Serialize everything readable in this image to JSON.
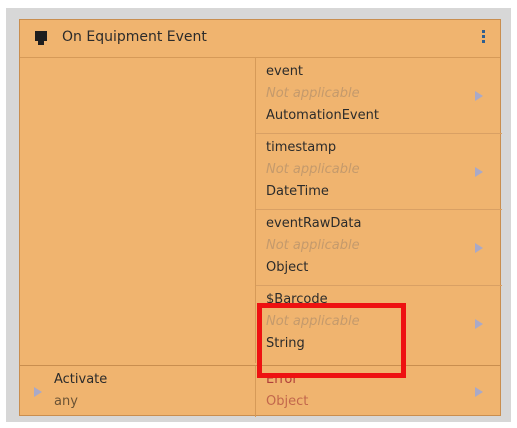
{
  "block": {
    "title": "On Equipment Event",
    "icon": "equipment-icon",
    "menu_icon": "kebab-menu-icon"
  },
  "outputs": [
    {
      "name": "event",
      "status": "Not applicable",
      "type": "AutomationEvent"
    },
    {
      "name": "timestamp",
      "status": "Not applicable",
      "type": "DateTime"
    },
    {
      "name": "eventRawData",
      "status": "Not applicable",
      "type": "Object"
    },
    {
      "name": "$Barcode",
      "status": "Not applicable",
      "type": "String"
    }
  ],
  "input": {
    "name": "Activate",
    "type": "any"
  },
  "error_output": {
    "name": "Error",
    "type": "Object"
  },
  "colors": {
    "block_bg": "#f0b46f",
    "frame_bg": "#d7d7d7",
    "highlight": "#ee1111",
    "error_text": "#b0403a"
  }
}
